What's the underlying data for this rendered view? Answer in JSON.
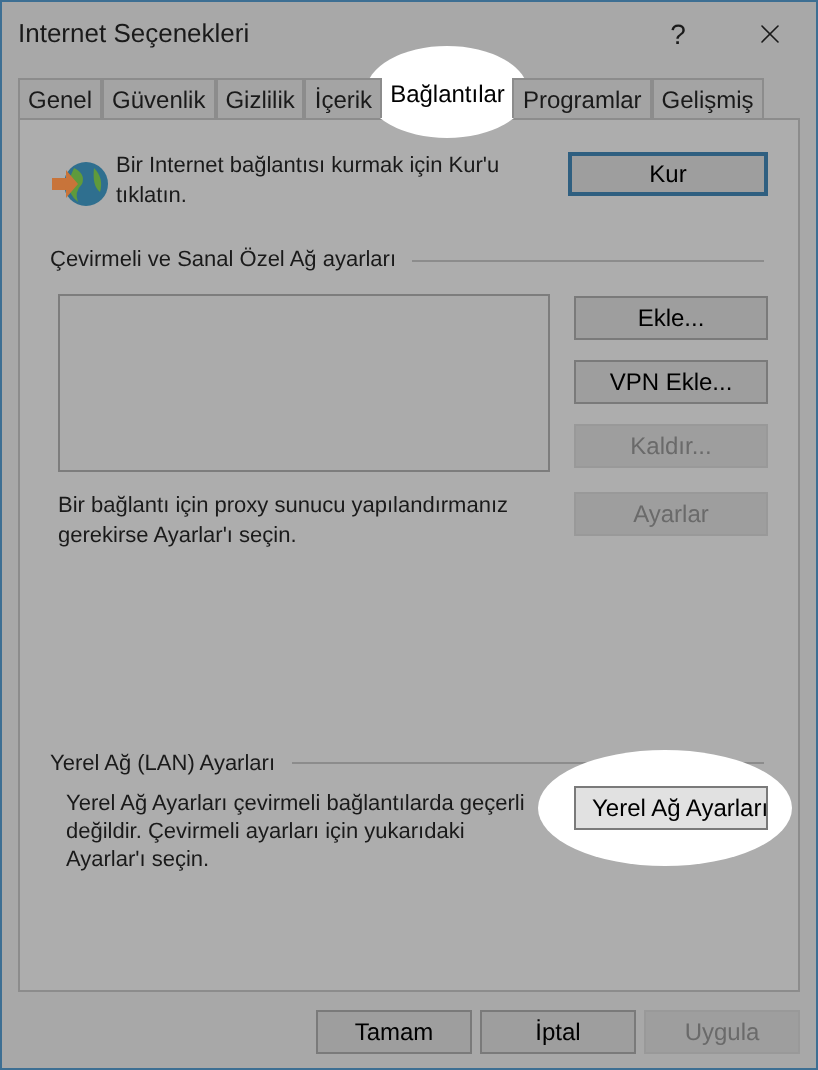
{
  "window": {
    "title": "Internet Seçenekleri",
    "help": "?"
  },
  "tabs": [
    {
      "label": "Genel",
      "selected": false,
      "highlighted": false
    },
    {
      "label": "Güvenlik",
      "selected": false,
      "highlighted": false
    },
    {
      "label": "Gizlilik",
      "selected": false,
      "highlighted": false
    },
    {
      "label": "İçerik",
      "selected": false,
      "highlighted": false
    },
    {
      "label": "Bağlantılar",
      "selected": true,
      "highlighted": true
    },
    {
      "label": "Programlar",
      "selected": false,
      "highlighted": false
    },
    {
      "label": "Gelişmiş",
      "selected": false,
      "highlighted": false
    }
  ],
  "setup": {
    "text": "Bir Internet bağlantısı kurmak için Kur'u tıklatın.",
    "button": {
      "label": "Kur",
      "default": true,
      "disabled": false,
      "highlighted": false
    }
  },
  "dialup": {
    "heading": "Çevirmeli ve Sanal Özel Ağ ayarları",
    "buttons": [
      {
        "label": "Ekle...",
        "default": false,
        "disabled": false,
        "highlighted": false
      },
      {
        "label": "VPN Ekle...",
        "default": false,
        "disabled": false,
        "highlighted": false
      },
      {
        "label": "Kaldır...",
        "default": false,
        "disabled": true,
        "highlighted": false
      }
    ],
    "proxy_text": "Bir bağlantı için proxy sunucu yapılandırmanız gerekirse Ayarlar'ı seçin.",
    "settings_button": {
      "label": "Ayarlar",
      "default": false,
      "disabled": true,
      "highlighted": false
    }
  },
  "lan": {
    "heading": "Yerel Ağ (LAN) Ayarları",
    "text": "Yerel Ağ Ayarları çevirmeli bağlantılarda geçerli değildir. Çevirmeli ayarları için yukarıdaki Ayarlar'ı seçin.",
    "button": {
      "label": "Yerel Ağ Ayarları",
      "default": false,
      "disabled": false,
      "highlighted": true
    }
  },
  "footer": [
    {
      "label": "Tamam",
      "default": false,
      "disabled": false,
      "highlighted": false
    },
    {
      "label": "İptal",
      "default": false,
      "disabled": false,
      "highlighted": false
    },
    {
      "label": "Uygula",
      "default": false,
      "disabled": true,
      "highlighted": false
    }
  ]
}
